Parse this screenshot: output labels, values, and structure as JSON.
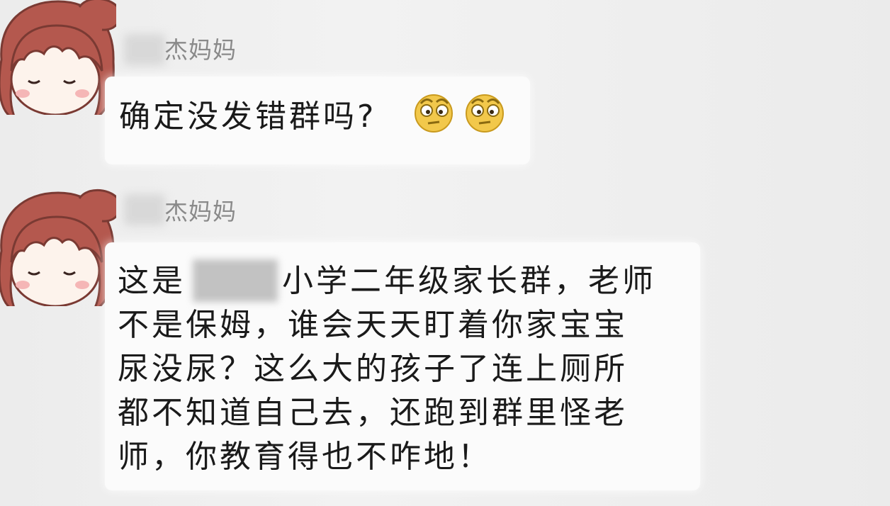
{
  "messages": [
    {
      "sender": "杰妈妈",
      "text": "确定没发错群吗?",
      "emojis": [
        "thinking-face-emoji",
        "thinking-face-emoji"
      ]
    },
    {
      "sender": "杰妈妈",
      "lines": [
        {
          "before": "这是",
          "after": "小学二年级家长群，老师"
        },
        {
          "text": "不是保姆，谁会天天盯着你家宝宝"
        },
        {
          "text": "尿没尿？这么大的孩子了连上厕所"
        },
        {
          "text": "都不知道自己去，还跑到群里怪老"
        },
        {
          "text": "师，你教育得也不咋地！"
        }
      ]
    }
  ],
  "colors": {
    "background": "#ededed",
    "bubble": "#fbfbfb",
    "text": "#1a1a1a",
    "sender": "#8a8a8a",
    "avatar_hair": "#b4584e",
    "avatar_face": "#fdf3ec"
  }
}
